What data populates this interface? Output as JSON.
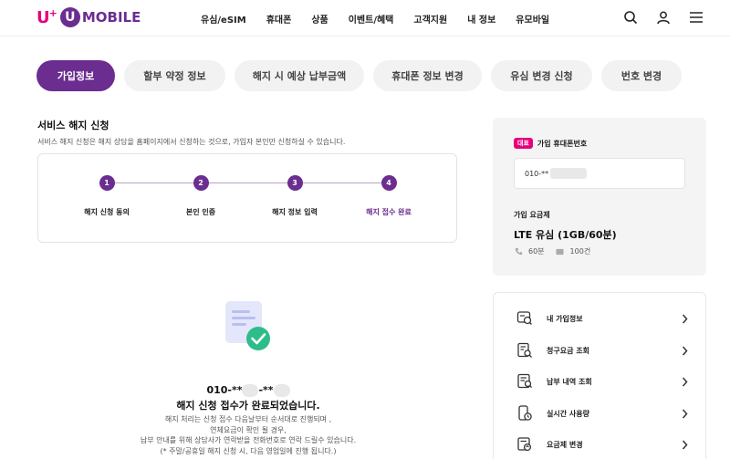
{
  "header": {
    "logo": {
      "prefix": "U",
      "prefix_sup": "+",
      "circle_letter": "U",
      "brand": "MOBILE"
    },
    "nav": [
      "유심/eSIM",
      "휴대폰",
      "상품",
      "이벤트/혜택",
      "고객지원",
      "내 정보",
      "유모바일"
    ],
    "icons": [
      "search-icon",
      "user-icon",
      "menu-icon"
    ]
  },
  "tabs": [
    {
      "label": "가입정보",
      "active": true
    },
    {
      "label": "할부 약정 정보",
      "active": false
    },
    {
      "label": "해지 시 예상 납부금액",
      "active": false
    },
    {
      "label": "휴대폰 정보 변경",
      "active": false
    },
    {
      "label": "유심 변경 신청",
      "active": false
    },
    {
      "label": "번호 변경",
      "active": false
    }
  ],
  "section": {
    "title": "서비스 해지 신청",
    "desc": "서비스 해지 신청은 해지 상담을 홈페이지에서 신청하는 것으로, 가입자 본인만 신청하실 수 있습니다."
  },
  "steps": [
    {
      "num": "1",
      "label": "해지 신청 동의"
    },
    {
      "num": "2",
      "label": "본인 인증"
    },
    {
      "num": "3",
      "label": "해지 정보 입력"
    },
    {
      "num": "4",
      "label": "해지 접수 완료"
    }
  ],
  "done": {
    "phone_a": "010-**",
    "phone_b": "-**",
    "title": "해지 신청 접수가 완료되었습니다.",
    "lines": [
      "해지 처리는 신청 접수 다음날부터 순서대로 진행되며 ,",
      "연체요금이 확인 될 경우,",
      "납부 안내를 위해 상담사가 연락받을 전화번호로 연락 드릴수 있습니다.",
      "(* 주말/공휴일 해지 신청 시, 다음 영업일에 진행 됩니다.)"
    ]
  },
  "account": {
    "badge": "대표",
    "rep_label": "가입 휴대폰번호",
    "phone": "010-**",
    "plan_label": "가입 요금제",
    "plan_name": "LTE 유심 (1GB/60분)",
    "call": "60분",
    "sms": "100건"
  },
  "menu": [
    {
      "label": "내 가입정보",
      "icon": "subscription-info-icon"
    },
    {
      "label": "청구요금 조회",
      "icon": "bill-search-icon"
    },
    {
      "label": "납부 내역 조회",
      "icon": "payment-history-icon"
    },
    {
      "label": "실시간 사용량",
      "icon": "realtime-usage-icon"
    },
    {
      "label": "요금제 변경",
      "icon": "plan-change-icon"
    }
  ],
  "colors": {
    "brand_purple": "#6b2d8f",
    "brand_pink": "#e6007e",
    "success_green": "#2ebd8a"
  }
}
